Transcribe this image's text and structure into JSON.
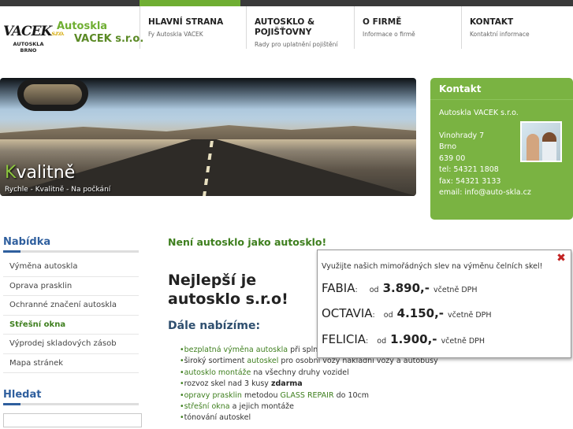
{
  "header": {
    "logo_mark": "VACEK",
    "logo_mark_suffix": "s.r.o.",
    "logo_sub1": "AUTOSKLA",
    "logo_sub2": "BRNO",
    "brand_line1": "Autoskla",
    "brand_line2": "VACEK s.r.o."
  },
  "nav": [
    {
      "title": "HLAVNÍ STRANA",
      "sub": "Fy Autoskla VACEK"
    },
    {
      "title": "AUTOSKLO & POJIŠŤOVNY",
      "sub": "Rady pro uplatnění pojištění"
    },
    {
      "title": "O FIRMĚ",
      "sub": "Informace o firmě"
    },
    {
      "title": "KONTAKT",
      "sub": "Kontaktní informace"
    }
  ],
  "hero": {
    "title_first": "K",
    "title_rest": "valitně",
    "tagline": "Rychle - Kvalitně - Na počkání"
  },
  "contact": {
    "heading": "Kontakt",
    "company": "Autoskla VACEK s.r.o.",
    "street": "Vinohrady 7",
    "city": "Brno",
    "zip": "639 00",
    "tel": "tel: 54321 1808",
    "fax": "fax: 54321 3133",
    "email": "email: info@auto-skla.cz"
  },
  "sidebar": {
    "heading": "Nabídka",
    "items": [
      {
        "label": "Výměna autoskla"
      },
      {
        "label": "Oprava prasklin"
      },
      {
        "label": "Ochranné značení autoskla"
      },
      {
        "label": "Střešní okna"
      },
      {
        "label": "Výprodej skladových zásob"
      },
      {
        "label": "Mapa stránek"
      }
    ],
    "search_heading": "Hledat"
  },
  "main": {
    "intro": "Není autosklo jako autosklo!",
    "headline": "Nejlepší je autosklo s.r.o!",
    "subheading": "Dále nabízíme:",
    "list": [
      {
        "a": "bezplatná výměna autoskla",
        "b": " při splnění podmínek"
      },
      {
        "pre": "široký sortiment ",
        "a": "autoskel",
        "b": " pro osobní vozy nákladní vozy a autobusy"
      },
      {
        "a": "autosklo montáže",
        "b": " na všechny druhy vozidel"
      },
      {
        "pre": "rozvoz skel nad 3 kusy ",
        "strong": "zdarma"
      },
      {
        "a": "opravy prasklin",
        "b": " metodou ",
        "a2": "GLASS REPAIR",
        "c": " do 10cm"
      },
      {
        "a": "střešní okna",
        "b": " a jejich montáže"
      },
      {
        "pre": "tónování autoskel"
      }
    ]
  },
  "popup": {
    "message": "Využijte našich mimořádných slev na výměnu čelních skel!",
    "close_symbol": "✖",
    "offers": [
      {
        "model": "FABIA",
        "colon": ":",
        "pre": "od",
        "price": "3.890,-",
        "post": "včetně DPH"
      },
      {
        "model": "OCTAVIA",
        "colon": ":",
        "pre": "od",
        "price": "4.150,-",
        "post": "včetně DPH"
      },
      {
        "model": "FELICIA",
        "colon": ":",
        "pre": "od",
        "price": "1.900,-",
        "post": "včetně DPH"
      }
    ]
  },
  "colors": {
    "accent_green": "#6fae32",
    "contact_green": "#7ab342",
    "heading_blue": "#2f5f9e",
    "close_red": "#c22222"
  }
}
